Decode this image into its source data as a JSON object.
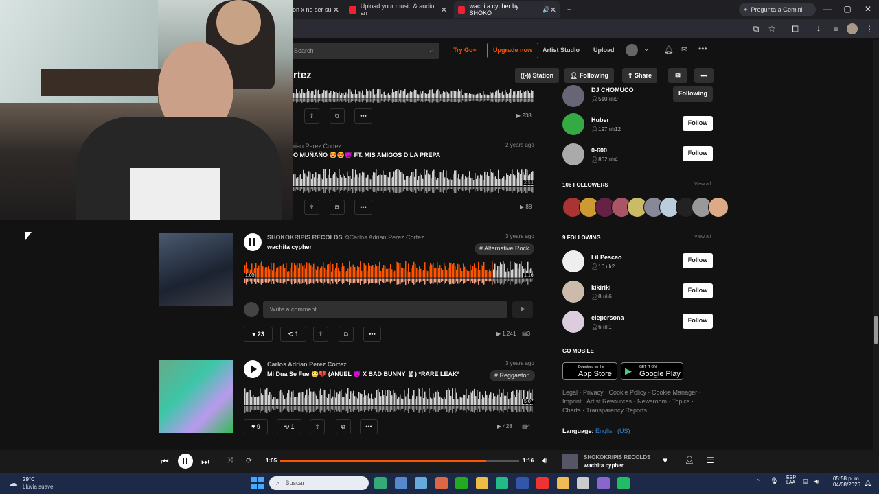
{
  "browser": {
    "tabs": [
      {
        "label": "on x no ser su"
      },
      {
        "label": "Upload your music & audio an"
      },
      {
        "label": "wachita cypher by SHOKO"
      }
    ],
    "gemini": "Pregunta a Gemini"
  },
  "header": {
    "search_placeholder": "Search",
    "try_go": "Try Go+",
    "upgrade": "Upgrade now",
    "artist_studio": "Artist Studio",
    "upload": "Upload"
  },
  "profile": {
    "name_fragment": "rtez",
    "station": "Station",
    "following": "Following",
    "share": "Share"
  },
  "feed": [
    {
      "plays": "238"
    },
    {
      "uploader": "rian Perez Cortez",
      "ago": "2 years ago",
      "title": "O MUÑAÑO 😍😍👿 FT. MIS AMIGOS D LA PREPA",
      "duration": "2:53",
      "plays": "88"
    },
    {
      "uploader": "SHOKOKRIPIS RECOLDS",
      "repost": "Carlos Adrian Perez Cortez",
      "ago": "3 years ago",
      "title": "wachita cypher",
      "tag": "# Alternative Rock",
      "current": "1:05",
      "duration": "1:16",
      "comment_placeholder": "Write a comment",
      "likes": "23",
      "reposts": "1",
      "plays": "1,241",
      "comments": "3"
    },
    {
      "uploader": "Carlos Adrian Perez Cortez",
      "ago": "3 years ago",
      "title": "Mi Dua Se Fue 😳💔 (ANUEL 👿 X BAD BUNNY 🐰) *RARE LEAK*",
      "tag": "# Reggaeton",
      "duration": "5:07",
      "likes": "9",
      "reposts": "1",
      "plays": "428",
      "comments": "4"
    }
  ],
  "sidebar": {
    "top_users": [
      {
        "name": "DJ CHOMUCO",
        "followers": "510",
        "tracks": "9",
        "button": "Following"
      },
      {
        "name": "Huber",
        "followers": "197",
        "tracks": "12",
        "button": "Follow"
      },
      {
        "name": "0-600",
        "followers": "802",
        "tracks": "4",
        "button": "Follow"
      }
    ],
    "followers_title": "106 FOLLOWERS",
    "view_all": "View all",
    "following_title": "9 FOLLOWING",
    "following_users": [
      {
        "name": "Lil Pescao",
        "followers": "10",
        "tracks": "2",
        "button": "Follow"
      },
      {
        "name": "kikiriki",
        "followers": "8",
        "tracks": "6",
        "button": "Follow"
      },
      {
        "name": "elepersona",
        "followers": "6",
        "tracks": "1",
        "button": "Follow"
      }
    ],
    "go_mobile": "GO MOBILE",
    "app_store_small": "Download on the",
    "app_store": "App Store",
    "google_small": "GET IT ON",
    "google_play": "Google Play",
    "footer_line1": "Legal · Privacy · Cookie Policy · Cookie Manager ·",
    "footer_line2": "Imprint · Artist Resources · Newsroom · Topics ·",
    "footer_line3": "Charts · Transparency Reports",
    "language_label": "Language:",
    "language": "English (US)"
  },
  "player": {
    "current": "1:05",
    "total": "1:16",
    "progress": 0.86,
    "artist": "SHOKOKRIPIS RECOLDS",
    "track": "wachita cypher"
  },
  "taskbar": {
    "temp": "29°C",
    "weather": "Lluvia suave",
    "search": "Buscar",
    "lang1": "ESP",
    "lang2": "LAA",
    "time": "05:58 p. m.",
    "date": "04/08/2026"
  },
  "colors": {
    "accent": "#ff5500",
    "bg": "#121212"
  }
}
